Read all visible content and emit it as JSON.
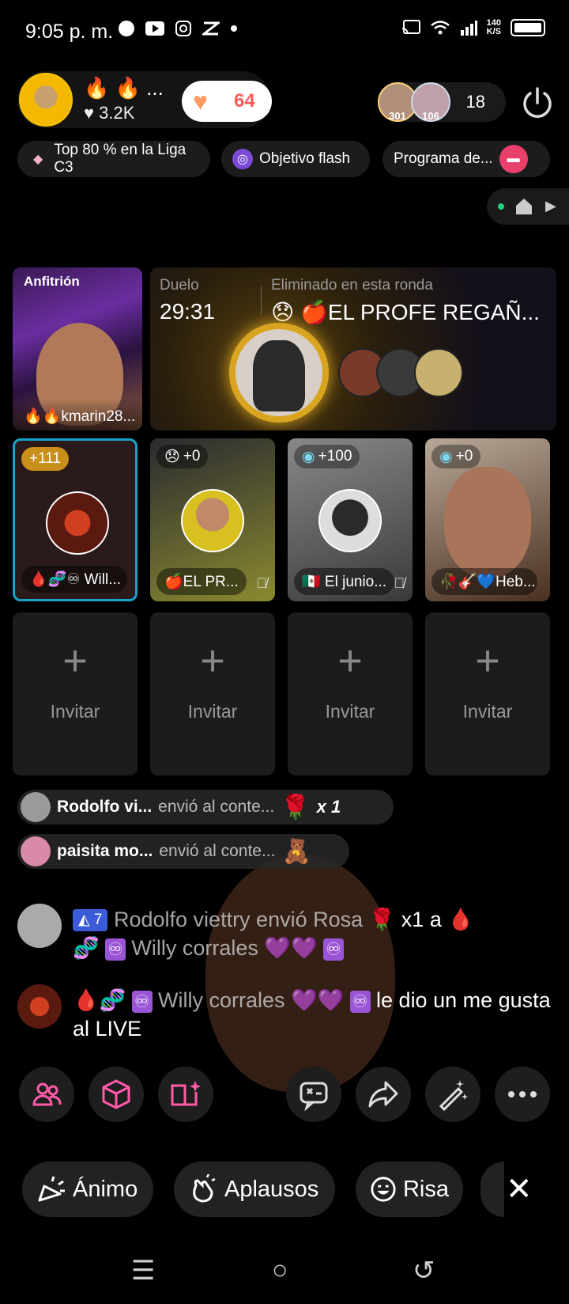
{
  "status_bar": {
    "time": "9:05 p. m.",
    "speed_value": "140",
    "speed_unit": "K/S"
  },
  "host": {
    "name": "🔥 🔥 ...",
    "likes": "♥ 3.2K",
    "like_count": "64",
    "viewer_badge_1": "301",
    "viewer_badge_2": "106",
    "viewer_count": "18"
  },
  "chips": [
    {
      "label": "Top 80 % en la Liga C3",
      "icon": "diamond-icon"
    },
    {
      "label": "Objetivo flash",
      "icon": "target-icon"
    },
    {
      "label": "Programa de...",
      "icon": "program-icon"
    }
  ],
  "battle": {
    "host_tile_label": "Anfitrión",
    "host_tile_name": "🔥🔥kmarin28...",
    "duel_label": "Duelo",
    "duel_timer": "29:31",
    "eliminated_label": "Eliminado en esta ronda",
    "eliminated_name": "😞 🍎EL PROFE REGAÑ..."
  },
  "guests": [
    {
      "score": "+111",
      "name": "🩸🧬♾ Will...",
      "bg": "#2b1a1a",
      "accent": "#17a2c8"
    },
    {
      "score": "+0",
      "name": "🍎EL PR...",
      "bg": "#5a5a20"
    },
    {
      "score": "+100",
      "name": "🇲🇽 El junio...",
      "bg": "#6a6a6a"
    },
    {
      "score": "+0",
      "name": "🥀🎸💙Heb...",
      "bg": "#5a4a40"
    }
  ],
  "invite": {
    "label": "Invitar",
    "plus": "+"
  },
  "gifts": [
    {
      "user": "Rodolfo vi...",
      "text": "envió al conte...",
      "gift": "🌹",
      "count": "x 1"
    },
    {
      "user": "paisita mo...",
      "text": "envió al conte...",
      "gift": "🧸"
    }
  ],
  "chat": [
    {
      "badge": "◭ 7",
      "user": "Rodolfo viettry envió Rosa",
      "gift": "🌹",
      "rest": "x1 a 🩸",
      "line2_prefix": "🧬",
      "line2_user": "Willy corrales 💜💜"
    },
    {
      "prefix": "🩸🧬",
      "user": "Willy corrales 💜💜",
      "rest": "le dio un me gusta al LIVE"
    }
  ],
  "reactions": [
    {
      "label": "Ánimo",
      "icon": "cheer-icon"
    },
    {
      "label": "Aplausos",
      "icon": "clap-icon"
    },
    {
      "label": "Risa",
      "icon": "laugh-icon"
    }
  ],
  "nav": {
    "menu": "☰",
    "home": "○",
    "back": "↺"
  }
}
